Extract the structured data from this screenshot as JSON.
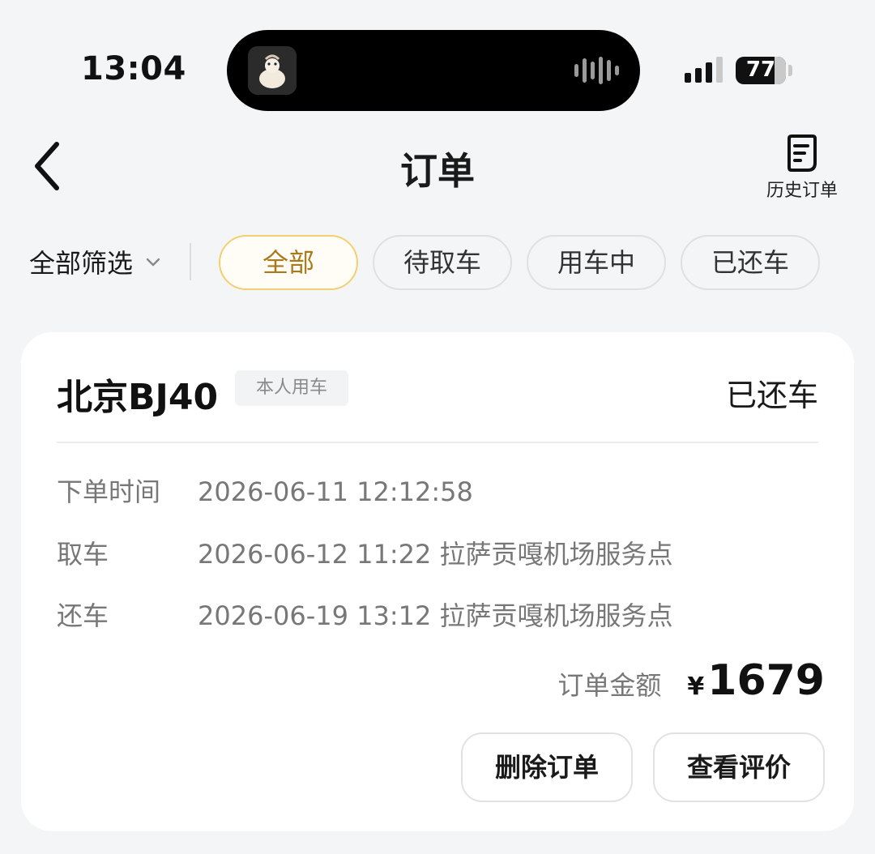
{
  "status_bar": {
    "time": "13:04",
    "battery": "77"
  },
  "nav": {
    "title": "订单",
    "history_label": "历史订单"
  },
  "filter": {
    "dropdown_label": "全部筛选",
    "tabs": [
      {
        "label": "全部",
        "active": true
      },
      {
        "label": "待取车",
        "active": false
      },
      {
        "label": "用车中",
        "active": false
      },
      {
        "label": "已还车",
        "active": false
      }
    ]
  },
  "order": {
    "car_name": "北京BJ40",
    "usage_type": "本人用车",
    "status": "已还车",
    "order_time_label": "下单时间",
    "order_time": "2026-06-11 12:12:58",
    "pickup_label": "取车",
    "pickup": "2026-06-12 11:22 拉萨贡嘎机场服务点",
    "return_label": "还车",
    "return": "2026-06-19 13:12 拉萨贡嘎机场服务点",
    "amount_label": "订单金额",
    "currency": "¥",
    "amount": "1679",
    "delete_label": "删除订单",
    "review_label": "查看评价"
  },
  "colors": {
    "accent_gold": "#a87a1c",
    "accent_border": "#f2cf72",
    "background": "#f4f5f7"
  }
}
